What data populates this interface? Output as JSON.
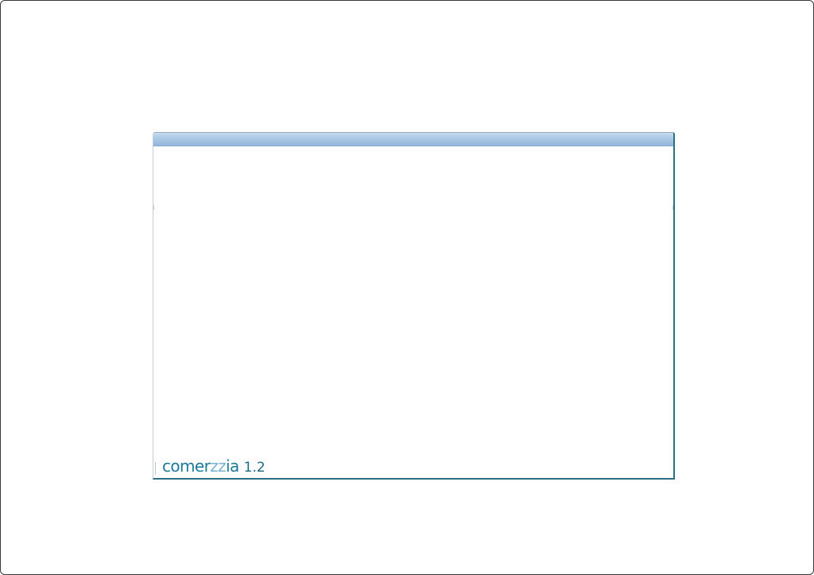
{
  "brand": {
    "name_pre": "comer",
    "name_highlight": "zz",
    "name_post": "ia",
    "version": "1.2"
  },
  "colors": {
    "brand_primary": "#1a7a98",
    "brand_highlight": "#7ab2d6",
    "window_border": "#2d6e82",
    "titlebar": "#a9c8e4"
  }
}
